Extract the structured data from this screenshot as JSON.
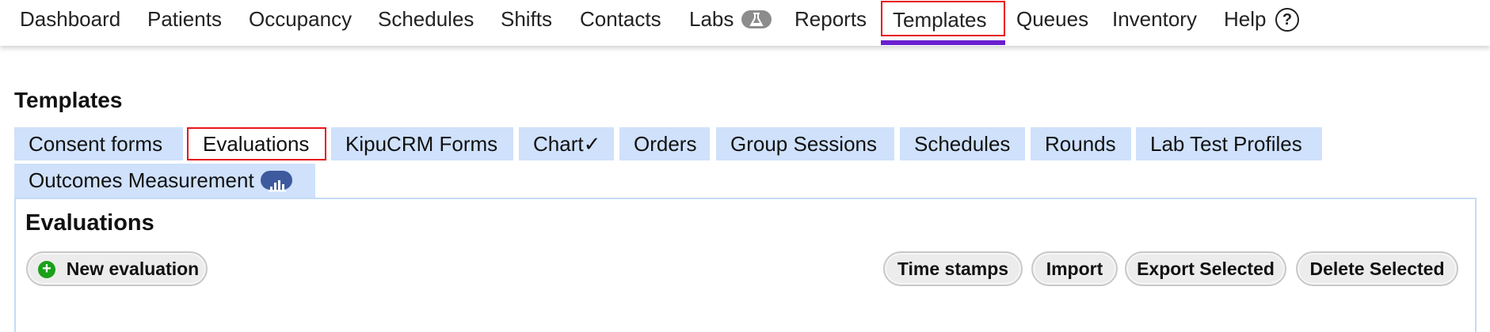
{
  "topnav": {
    "items": [
      {
        "label": "Dashboard"
      },
      {
        "label": "Patients"
      },
      {
        "label": "Occupancy"
      },
      {
        "label": "Schedules"
      },
      {
        "label": "Shifts"
      },
      {
        "label": "Contacts"
      },
      {
        "label": "Labs",
        "icon": "flask-icon"
      },
      {
        "label": "Reports"
      },
      {
        "label": "Templates",
        "active": true
      },
      {
        "label": "Queues"
      },
      {
        "label": "Inventory"
      },
      {
        "label": "Help",
        "icon": "help-circle-icon"
      }
    ],
    "help_symbol": "?",
    "active_color": "#6a1fd0"
  },
  "page": {
    "title": "Templates"
  },
  "subtabs": [
    {
      "label": "Consent forms"
    },
    {
      "label": "Evaluations",
      "active": true
    },
    {
      "label": "KipuCRM Forms"
    },
    {
      "label": "Chart✓"
    },
    {
      "label": "Orders"
    },
    {
      "label": "Group Sessions"
    },
    {
      "label": "Schedules"
    },
    {
      "label": "Rounds"
    },
    {
      "label": "Lab Test Profiles"
    },
    {
      "label": "Outcomes Measurement",
      "icon": "bar-chart-icon"
    }
  ],
  "panel": {
    "title": "Evaluations",
    "buttons": {
      "new": "New evaluation",
      "time_stamps": "Time stamps",
      "import": "Import",
      "export": "Export Selected",
      "delete": "Delete Selected"
    }
  },
  "colors": {
    "tab_bg": "#cfe1fb",
    "highlight_border": "#e8141a",
    "plus_green": "#1aa01a"
  }
}
